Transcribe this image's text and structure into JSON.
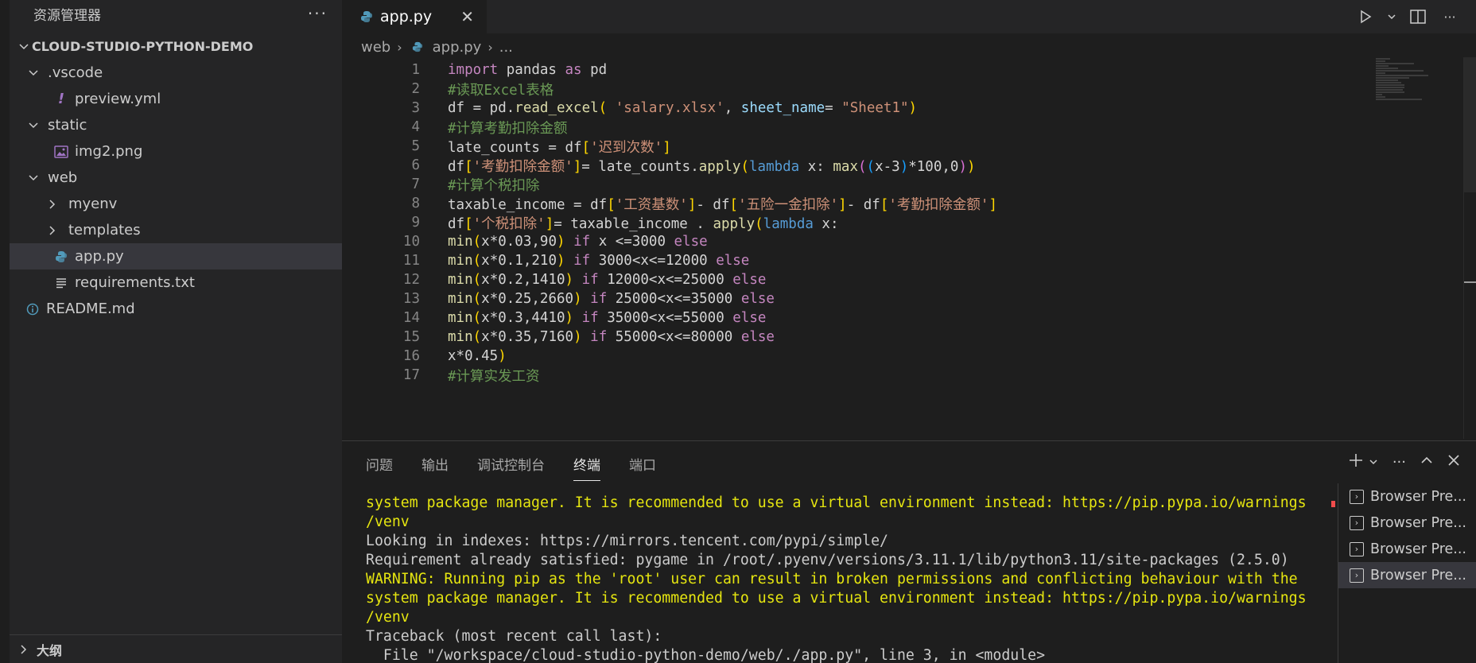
{
  "explorer": {
    "title": "资源管理器",
    "more": "···",
    "project": "CLOUD-STUDIO-PYTHON-DEMO",
    "items": [
      {
        "label": ".vscode",
        "type": "folder-open"
      },
      {
        "label": "preview.yml",
        "type": "yml"
      },
      {
        "label": "static",
        "type": "folder-open"
      },
      {
        "label": "img2.png",
        "type": "image"
      },
      {
        "label": "web",
        "type": "folder-open"
      },
      {
        "label": "myenv",
        "type": "folder"
      },
      {
        "label": "templates",
        "type": "folder"
      },
      {
        "label": "app.py",
        "type": "python"
      },
      {
        "label": "requirements.txt",
        "type": "text"
      },
      {
        "label": "README.md",
        "type": "info"
      }
    ],
    "outline": "大纲"
  },
  "editor": {
    "tab_label": "app.py",
    "breadcrumb": [
      "web",
      "app.py",
      "..."
    ],
    "lines": [
      "import pandas as pd",
      "#读取Excel表格",
      "df = pd.read_excel( 'salary.xlsx', sheet_name= \"Sheet1\")",
      "#计算考勤扣除金额",
      "late_counts = df['迟到次数']",
      "df['考勤扣除金额']= late_counts.apply(lambda x: max((x-3)*100,0))",
      "#计算个税扣除",
      "taxable_income = df['工资基数']- df['五险一金扣除']- df['考勤扣除金额']",
      "df['个税扣除']= taxable_income . apply(lambda x:",
      "min(x*0.03,90) if x <=3000 else",
      "min(x*0.1,210) if 3000<x<=12000 else",
      "min(x*0.2,1410) if 12000<x<=25000 else",
      "min(x*0.25,2660) if 25000<x<=35000 else",
      "min(x*0.3,4410) if 35000<x<=55000 else",
      "min(x*0.35,7160) if 55000<x<=80000 else",
      "x*0.45)",
      "#计算实发工资"
    ]
  },
  "panel": {
    "tabs": [
      "问题",
      "输出",
      "调试控制台",
      "终端",
      "端口"
    ],
    "active_tab": "终端",
    "terminal_lines": [
      {
        "text": "system package manager. It is recommended to use a virtual environment instead: https://pip.pypa.io/warnings",
        "kind": "warn"
      },
      {
        "text": "/venv",
        "kind": "warn"
      },
      {
        "text": "Looking in indexes: https://mirrors.tencent.com/pypi/simple/",
        "kind": "norm"
      },
      {
        "text": "Requirement already satisfied: pygame in /root/.pyenv/versions/3.11.1/lib/python3.11/site-packages (2.5.0)",
        "kind": "norm"
      },
      {
        "text": "WARNING: Running pip as the 'root' user can result in broken permissions and conflicting behaviour with the",
        "kind": "warn"
      },
      {
        "text": "system package manager. It is recommended to use a virtual environment instead: https://pip.pypa.io/warnings",
        "kind": "warn"
      },
      {
        "text": "/venv",
        "kind": "warn"
      },
      {
        "text": "Traceback (most recent call last):",
        "kind": "norm"
      },
      {
        "text": "  File \"/workspace/cloud-studio-python-demo/web/./app.py\", line 3, in <module>",
        "kind": "norm"
      }
    ],
    "terminals": [
      "Browser Pre...",
      "Browser Pre...",
      "Browser Pre...",
      "Browser Pre..."
    ]
  },
  "colors": {
    "background": "#1e1e1e",
    "sidebar": "#252526",
    "selection": "#37373d",
    "warning_text": "#e5e510"
  }
}
